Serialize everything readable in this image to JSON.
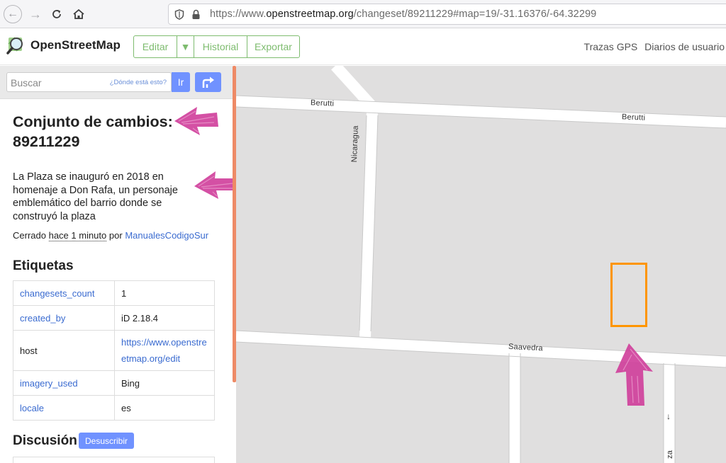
{
  "browser": {
    "url_prefix": "https://www.",
    "url_host": "openstreetmap.org",
    "url_path": "/changeset/89211229#map=19/-31.16376/-64.32299"
  },
  "header": {
    "logo_text": "OpenStreetMap",
    "edit_label": "Editar",
    "history_label": "Historial",
    "export_label": "Exportar",
    "gps_traces": "Trazas GPS",
    "user_diaries": "Diarios de usuario"
  },
  "search": {
    "placeholder": "Buscar",
    "where_is_this": "¿Dónde está esto?",
    "go_label": "Ir"
  },
  "changeset": {
    "title": "Conjunto de cambios: 89211229",
    "comment": "La Plaza se inauguró en 2018 en homenaje a Don Rafa, un personaje emblemático del barrio donde se construyó la plaza",
    "closed_prefix": "Cerrado",
    "closed_time": "hace 1 minuto",
    "by_word": "por",
    "user": "ManualesCodigoSur"
  },
  "tags": {
    "title": "Etiquetas",
    "rows": [
      {
        "key": "changesets_count",
        "value": "1"
      },
      {
        "key": "created_by",
        "value": "iD 2.18.4"
      },
      {
        "key": "host",
        "value": "https://www.openstreetmap.org/edit"
      },
      {
        "key": "imagery_used",
        "value": "Bing"
      },
      {
        "key": "locale",
        "value": "es"
      }
    ]
  },
  "discussion": {
    "title": "Discusión",
    "unsubscribe_label": "Desuscribir"
  },
  "map": {
    "streets": [
      {
        "name": "Berutti"
      },
      {
        "name": "Berutti"
      },
      {
        "name": "Nicaragua"
      },
      {
        "name": "Saavedra"
      },
      {
        "name": "za"
      }
    ],
    "one_way_arrow": "↓",
    "selection_color": "#ff9500"
  },
  "colors": {
    "osm_green": "#7ebc6f",
    "button_blue": "#7092ff",
    "link_blue": "#3a6bd0",
    "annotation_magenta": "#cf3d9a",
    "scrollbar_orange": "#ee8a66"
  }
}
